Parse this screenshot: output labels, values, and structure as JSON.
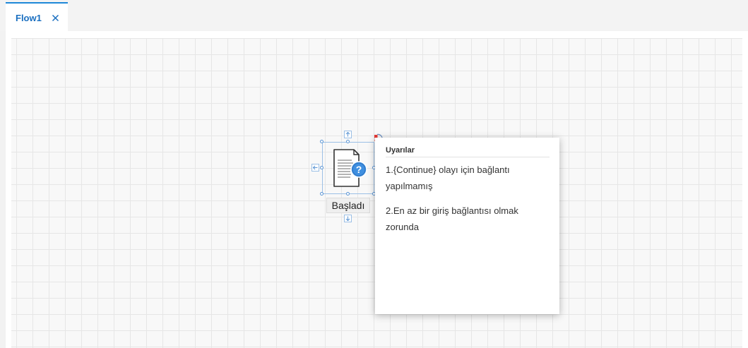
{
  "tab": {
    "label": "Flow1",
    "close_icon": "close-icon"
  },
  "node": {
    "label": "Başladı",
    "icon": "document-question-icon"
  },
  "warnings": {
    "title": "Uyarılar",
    "items": [
      "1.{Continue} olayı için bağlantı yapılmamış",
      "2.En az bir giriş bağlantısı olmak zorunda"
    ]
  },
  "colors": {
    "accent": "#1e88d8",
    "tab_text": "#1a6fc0",
    "selection": "#5b95d4",
    "warning": "#e53935"
  }
}
